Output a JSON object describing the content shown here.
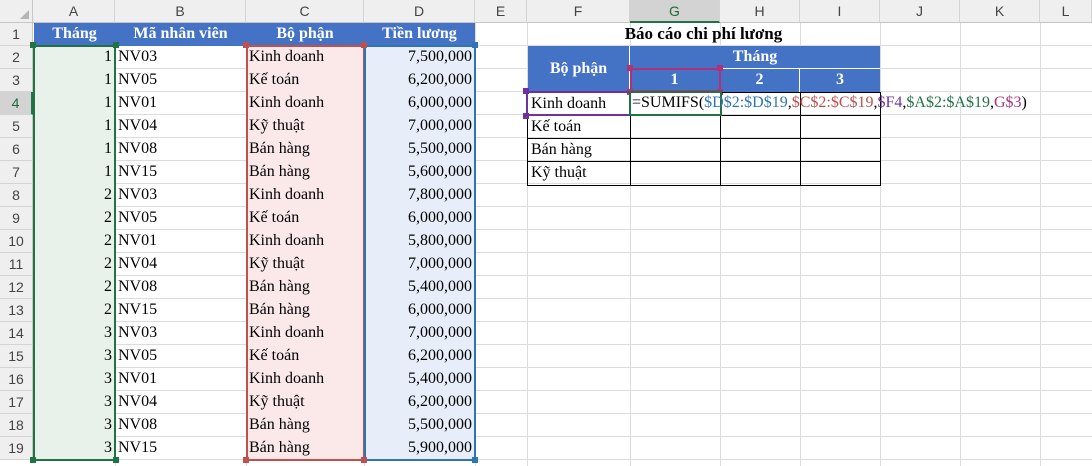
{
  "columns": [
    "A",
    "B",
    "C",
    "D",
    "E",
    "F",
    "G",
    "H",
    "I",
    "J",
    "K",
    "L"
  ],
  "rows": [
    "1",
    "2",
    "3",
    "4",
    "5",
    "6",
    "7",
    "8",
    "9",
    "10",
    "11",
    "12",
    "13",
    "14",
    "15",
    "16",
    "17",
    "18",
    "19"
  ],
  "headers": {
    "a": "Tháng",
    "b": "Mã nhân viên",
    "c": "Bộ phận",
    "d": "Tiền lương"
  },
  "data_rows": [
    {
      "thang": "1",
      "ma": "NV03",
      "bophan": "Kinh doanh",
      "luong": "7,500,000"
    },
    {
      "thang": "1",
      "ma": "NV05",
      "bophan": "Kế toán",
      "luong": "6,200,000"
    },
    {
      "thang": "1",
      "ma": "NV01",
      "bophan": "Kinh doanh",
      "luong": "6,000,000"
    },
    {
      "thang": "1",
      "ma": "NV04",
      "bophan": "Kỹ thuật",
      "luong": "7,000,000"
    },
    {
      "thang": "1",
      "ma": "NV08",
      "bophan": "Bán hàng",
      "luong": "5,500,000"
    },
    {
      "thang": "1",
      "ma": "NV15",
      "bophan": "Bán hàng",
      "luong": "5,600,000"
    },
    {
      "thang": "2",
      "ma": "NV03",
      "bophan": "Kinh doanh",
      "luong": "7,800,000"
    },
    {
      "thang": "2",
      "ma": "NV05",
      "bophan": "Kế toán",
      "luong": "6,000,000"
    },
    {
      "thang": "2",
      "ma": "NV01",
      "bophan": "Kinh doanh",
      "luong": "5,800,000"
    },
    {
      "thang": "2",
      "ma": "NV04",
      "bophan": "Kỹ thuật",
      "luong": "7,000,000"
    },
    {
      "thang": "2",
      "ma": "NV08",
      "bophan": "Bán hàng",
      "luong": "5,400,000"
    },
    {
      "thang": "2",
      "ma": "NV15",
      "bophan": "Bán hàng",
      "luong": "6,000,000"
    },
    {
      "thang": "3",
      "ma": "NV03",
      "bophan": "Kinh doanh",
      "luong": "7,000,000"
    },
    {
      "thang": "3",
      "ma": "NV05",
      "bophan": "Kế toán",
      "luong": "6,200,000"
    },
    {
      "thang": "3",
      "ma": "NV01",
      "bophan": "Kinh doanh",
      "luong": "5,400,000"
    },
    {
      "thang": "3",
      "ma": "NV04",
      "bophan": "Kỹ thuật",
      "luong": "6,200,000"
    },
    {
      "thang": "3",
      "ma": "NV08",
      "bophan": "Bán hàng",
      "luong": "5,500,000"
    },
    {
      "thang": "3",
      "ma": "NV15",
      "bophan": "Bán hàng",
      "luong": "5,900,000"
    }
  ],
  "report": {
    "title": "Báo cáo chi phí lương",
    "bophan_header": "Bộ phận",
    "thang_header": "Tháng",
    "months": [
      "1",
      "2",
      "3"
    ],
    "departments": [
      "Kinh doanh",
      "Kế toán",
      "Bán hàng",
      "Kỹ thuật"
    ]
  },
  "formula": {
    "prefix": "=SUMIFS(",
    "arg1": "$D$2:$D$19",
    "arg2": "$C$2:$C$19",
    "arg3": "$F4",
    "arg4": "$A$2:$A$19",
    "arg5": "G$3",
    "sep": ",",
    "suffix": ")"
  },
  "colors": {
    "header_blue": "#4472c4",
    "range_green": "#217346",
    "range_red": "#c0504d",
    "range_blue": "#2e75b6",
    "range_purple": "#7030a0",
    "range_magenta": "#b0307a"
  }
}
